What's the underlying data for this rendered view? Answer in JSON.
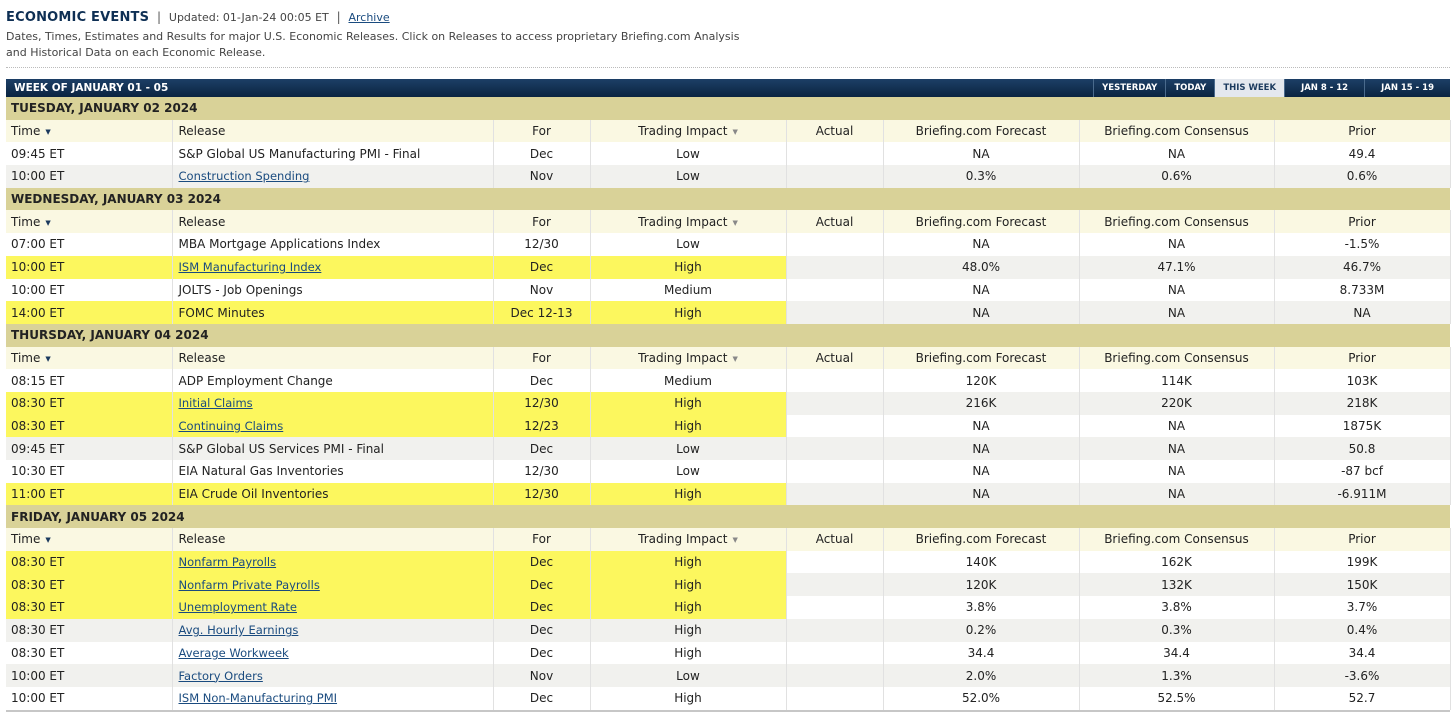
{
  "header": {
    "title": "ECONOMIC EVENTS",
    "separator": "|",
    "updated": "Updated: 01-Jan-24 00:05 ET",
    "separator2": "|",
    "archive_label": "Archive",
    "desc_line1": "Dates, Times, Estimates and Results for major U.S. Economic Releases. Click on Releases to access proprietary Briefing.com Analysis",
    "desc_line2": "and Historical Data on each Economic Release."
  },
  "weekbar": {
    "label": "WEEK OF JANUARY 01 - 05",
    "nav": [
      "YESTERDAY",
      "TODAY",
      "THIS WEEK",
      "JAN 8 - 12",
      "JAN 15 - 19"
    ],
    "active": "THIS WEEK"
  },
  "columns": {
    "time": "Time",
    "release": "Release",
    "for": "For",
    "impact": "Trading Impact",
    "actual": "Actual",
    "forecast": "Briefing.com Forecast",
    "consensus": "Briefing.com Consensus",
    "prior": "Prior",
    "sort_icon": "sort-down-icon"
  },
  "colors": {
    "highlight": "#fcf75e",
    "day_header": "#d9d298",
    "bar": "#0b2441"
  },
  "days": [
    {
      "label": "TUESDAY, JANUARY 02 2024",
      "events": [
        {
          "time": "09:45 ET",
          "release": "S&P Global US Manufacturing PMI - Final",
          "link": false,
          "for": "Dec",
          "impact": "Low",
          "actual": "",
          "forecast": "NA",
          "consensus": "NA",
          "prior": "49.4",
          "highlight": false
        },
        {
          "time": "10:00 ET",
          "release": "Construction Spending",
          "link": true,
          "for": "Nov",
          "impact": "Low",
          "actual": "",
          "forecast": "0.3%",
          "consensus": "0.6%",
          "prior": "0.6%",
          "highlight": false
        }
      ]
    },
    {
      "label": "WEDNESDAY, JANUARY 03 2024",
      "events": [
        {
          "time": "07:00 ET",
          "release": "MBA Mortgage Applications Index",
          "link": false,
          "for": "12/30",
          "impact": "Low",
          "actual": "",
          "forecast": "NA",
          "consensus": "NA",
          "prior": "-1.5%",
          "highlight": false
        },
        {
          "time": "10:00 ET",
          "release": "ISM Manufacturing Index",
          "link": true,
          "for": "Dec",
          "impact": "High",
          "actual": "",
          "forecast": "48.0%",
          "consensus": "47.1%",
          "prior": "46.7%",
          "highlight": true
        },
        {
          "time": "10:00 ET",
          "release": "JOLTS - Job Openings",
          "link": false,
          "for": "Nov",
          "impact": "Medium",
          "actual": "",
          "forecast": "NA",
          "consensus": "NA",
          "prior": "8.733M",
          "highlight": false
        },
        {
          "time": "14:00 ET",
          "release": "FOMC Minutes",
          "link": false,
          "for": "Dec 12-13",
          "impact": "High",
          "actual": "",
          "forecast": "NA",
          "consensus": "NA",
          "prior": "NA",
          "highlight": true
        }
      ]
    },
    {
      "label": "THURSDAY, JANUARY 04 2024",
      "events": [
        {
          "time": "08:15 ET",
          "release": "ADP Employment Change",
          "link": false,
          "for": "Dec",
          "impact": "Medium",
          "actual": "",
          "forecast": "120K",
          "consensus": "114K",
          "prior": "103K",
          "highlight": false
        },
        {
          "time": "08:30 ET",
          "release": "Initial Claims",
          "link": true,
          "for": "12/30",
          "impact": "High",
          "actual": "",
          "forecast": "216K",
          "consensus": "220K",
          "prior": "218K",
          "highlight": true
        },
        {
          "time": "08:30 ET",
          "release": "Continuing Claims",
          "link": true,
          "for": "12/23",
          "impact": "High",
          "actual": "",
          "forecast": "NA",
          "consensus": "NA",
          "prior": "1875K",
          "highlight": true
        },
        {
          "time": "09:45 ET",
          "release": "S&P Global US Services PMI - Final",
          "link": false,
          "for": "Dec",
          "impact": "Low",
          "actual": "",
          "forecast": "NA",
          "consensus": "NA",
          "prior": "50.8",
          "highlight": false
        },
        {
          "time": "10:30 ET",
          "release": "EIA Natural Gas Inventories",
          "link": false,
          "for": "12/30",
          "impact": "Low",
          "actual": "",
          "forecast": "NA",
          "consensus": "NA",
          "prior": "-87 bcf",
          "highlight": false
        },
        {
          "time": "11:00 ET",
          "release": "EIA Crude Oil Inventories",
          "link": false,
          "for": "12/30",
          "impact": "High",
          "actual": "",
          "forecast": "NA",
          "consensus": "NA",
          "prior": "-6.911M",
          "highlight": true
        }
      ]
    },
    {
      "label": "FRIDAY, JANUARY 05 2024",
      "events": [
        {
          "time": "08:30 ET",
          "release": "Nonfarm Payrolls",
          "link": true,
          "for": "Dec",
          "impact": "High",
          "actual": "",
          "forecast": "140K",
          "consensus": "162K",
          "prior": "199K",
          "highlight": true
        },
        {
          "time": "08:30 ET",
          "release": "Nonfarm Private Payrolls",
          "link": true,
          "for": "Dec",
          "impact": "High",
          "actual": "",
          "forecast": "120K",
          "consensus": "132K",
          "prior": "150K",
          "highlight": true
        },
        {
          "time": "08:30 ET",
          "release": "Unemployment Rate",
          "link": true,
          "for": "Dec",
          "impact": "High",
          "actual": "",
          "forecast": "3.8%",
          "consensus": "3.8%",
          "prior": "3.7%",
          "highlight": true
        },
        {
          "time": "08:30 ET",
          "release": "Avg. Hourly Earnings",
          "link": true,
          "for": "Dec",
          "impact": "High",
          "actual": "",
          "forecast": "0.2%",
          "consensus": "0.3%",
          "prior": "0.4%",
          "highlight": false
        },
        {
          "time": "08:30 ET",
          "release": "Average Workweek",
          "link": true,
          "for": "Dec",
          "impact": "High",
          "actual": "",
          "forecast": "34.4",
          "consensus": "34.4",
          "prior": "34.4",
          "highlight": false
        },
        {
          "time": "10:00 ET",
          "release": "Factory Orders",
          "link": true,
          "for": "Nov",
          "impact": "Low",
          "actual": "",
          "forecast": "2.0%",
          "consensus": "1.3%",
          "prior": "-3.6%",
          "highlight": false
        },
        {
          "time": "10:00 ET",
          "release": "ISM Non-Manufacturing PMI",
          "link": true,
          "for": "Dec",
          "impact": "High",
          "actual": "",
          "forecast": "52.0%",
          "consensus": "52.5%",
          "prior": "52.7",
          "highlight": false
        }
      ]
    }
  ]
}
